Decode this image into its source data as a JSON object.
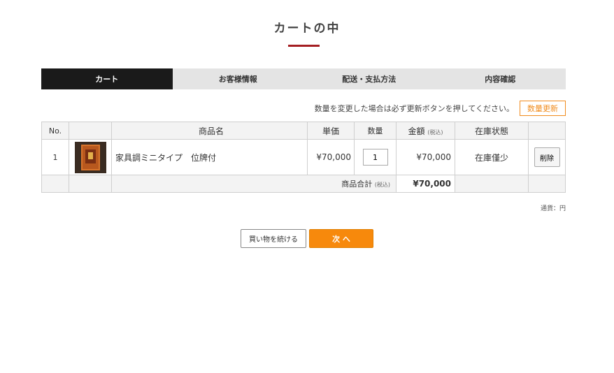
{
  "page": {
    "title": "カートの中",
    "accent_color": "#a41e22"
  },
  "steps": [
    {
      "label": "カート",
      "active": true
    },
    {
      "label": "お客様情報",
      "active": false
    },
    {
      "label": "配送・支払方法",
      "active": false
    },
    {
      "label": "内容確認",
      "active": false
    }
  ],
  "notice": {
    "text": "数量を変更した場合は必ず更新ボタンを押してください。",
    "update_button": "数量更新",
    "update_button_color": "#f08c1e"
  },
  "table": {
    "headers": {
      "no": "No.",
      "image": "",
      "name": "商品名",
      "unit_price": "単価",
      "quantity": "数量",
      "amount": "金額",
      "amount_tax_note": "(税込)",
      "stock": "在庫状態",
      "action": ""
    },
    "items": [
      {
        "no": "1",
        "image_icon": "product-thumbnail",
        "name": "家具調ミニタイプ　位牌付",
        "unit_price": "¥70,000",
        "quantity": "1",
        "amount": "¥70,000",
        "stock": "在庫僅少",
        "delete_label": "削除"
      }
    ],
    "total": {
      "label": "商品合計",
      "tax_note": "(税込)",
      "value": "¥70,000"
    }
  },
  "currency_note": "通貨：円",
  "buttons": {
    "continue": "買い物を続ける",
    "next": "次 へ",
    "next_color": "#f7890c"
  }
}
